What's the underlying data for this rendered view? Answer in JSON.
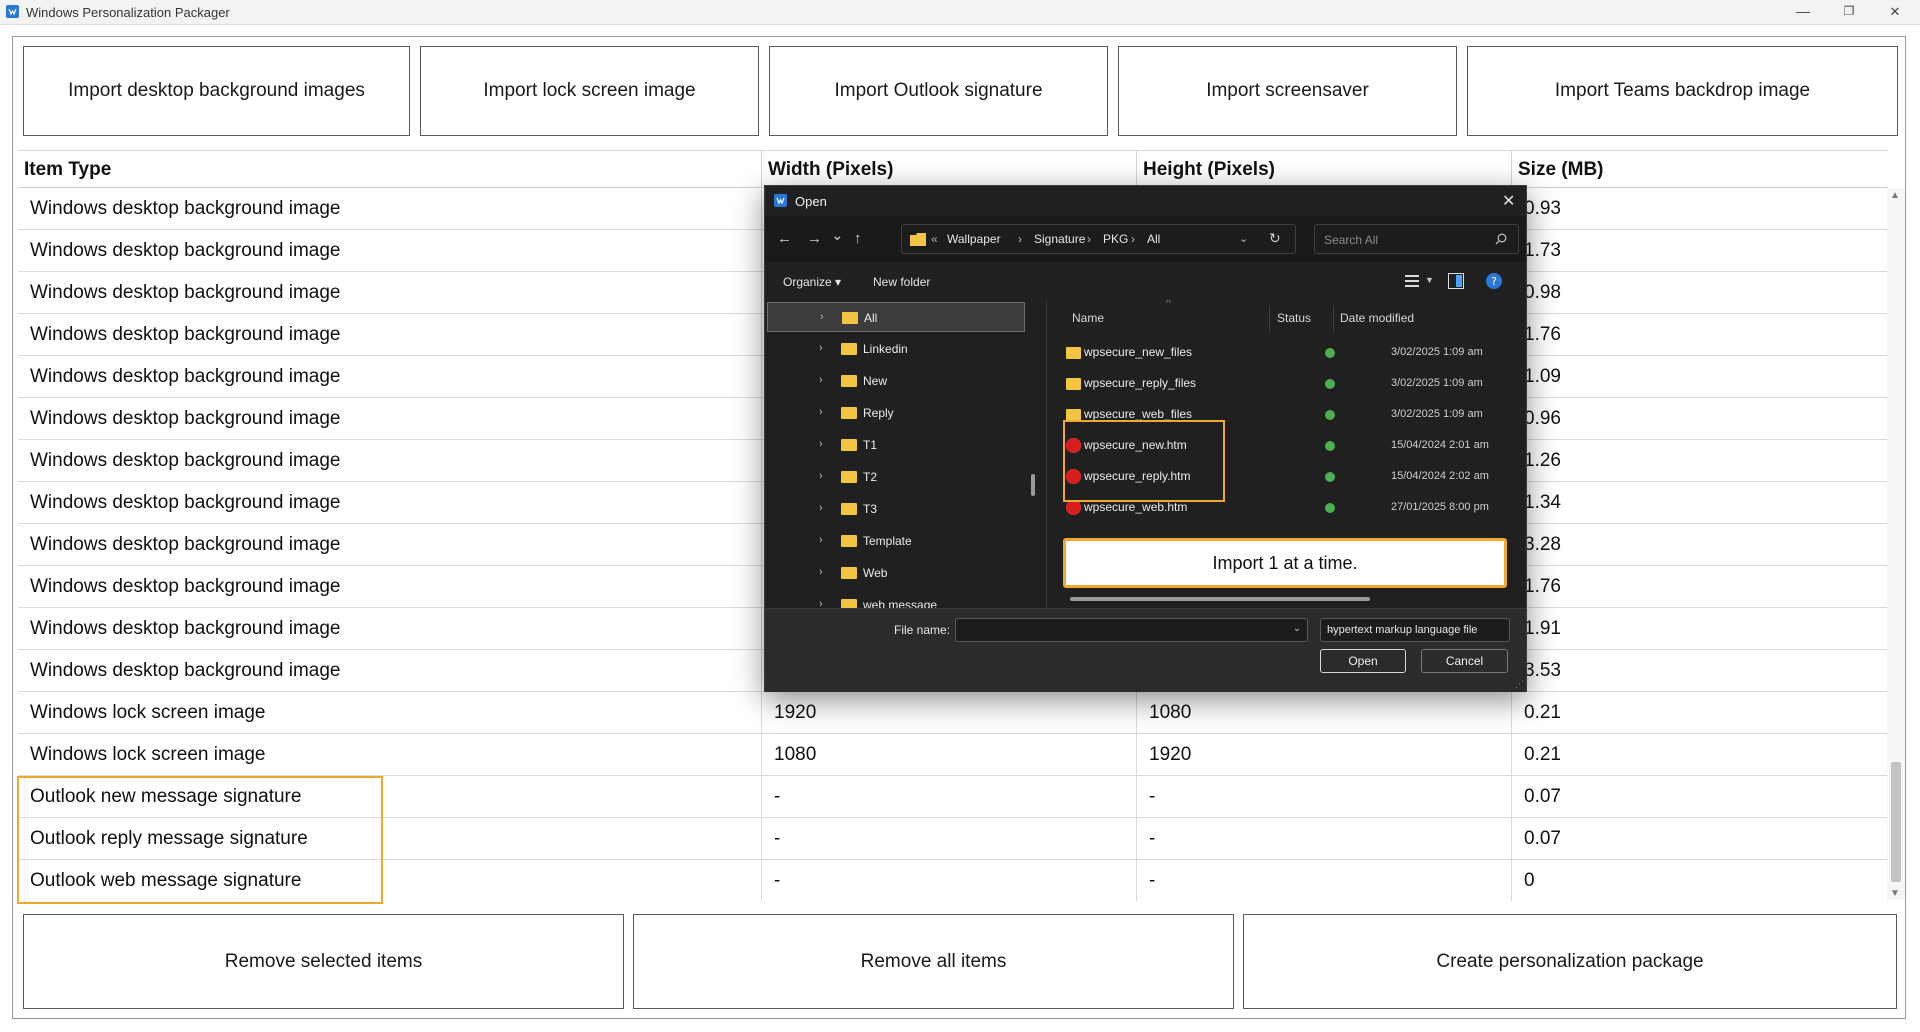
{
  "window": {
    "title": "Windows Personalization Packager",
    "minimize": "—",
    "restore": "❐",
    "close": "✕"
  },
  "top_buttons": [
    {
      "label": "Import desktop background images"
    },
    {
      "label": "Import lock screen image"
    },
    {
      "label": "Import Outlook signature"
    },
    {
      "label": "Import screensaver"
    },
    {
      "label": "Import Teams backdrop image"
    }
  ],
  "table": {
    "columns": [
      "Item Type",
      "Width (Pixels)",
      "Height (Pixels)",
      "Size (MB)"
    ],
    "rows": [
      {
        "type": "Windows desktop background image",
        "width": "",
        "height": "",
        "size": "0.93"
      },
      {
        "type": "Windows desktop background image",
        "width": "",
        "height": "",
        "size": "1.73"
      },
      {
        "type": "Windows desktop background image",
        "width": "",
        "height": "",
        "size": "0.98"
      },
      {
        "type": "Windows desktop background image",
        "width": "",
        "height": "",
        "size": "1.76"
      },
      {
        "type": "Windows desktop background image",
        "width": "",
        "height": "",
        "size": "1.09"
      },
      {
        "type": "Windows desktop background image",
        "width": "",
        "height": "",
        "size": "0.96"
      },
      {
        "type": "Windows desktop background image",
        "width": "",
        "height": "",
        "size": "1.26"
      },
      {
        "type": "Windows desktop background image",
        "width": "",
        "height": "",
        "size": "1.34"
      },
      {
        "type": "Windows desktop background image",
        "width": "",
        "height": "",
        "size": "3.28"
      },
      {
        "type": "Windows desktop background image",
        "width": "",
        "height": "",
        "size": "1.76"
      },
      {
        "type": "Windows desktop background image",
        "width": "",
        "height": "",
        "size": "1.91"
      },
      {
        "type": "Windows desktop background image",
        "width": "",
        "height": "",
        "size": "3.53"
      },
      {
        "type": "Windows lock screen image",
        "width": "1920",
        "height": "1080",
        "size": "0.21"
      },
      {
        "type": "Windows lock screen image",
        "width": "1080",
        "height": "1920",
        "size": "0.21"
      },
      {
        "type": "Outlook new message signature",
        "width": "-",
        "height": "-",
        "size": "0.07"
      },
      {
        "type": "Outlook reply message signature",
        "width": "-",
        "height": "-",
        "size": "0.07"
      },
      {
        "type": "Outlook web message signature",
        "width": "-",
        "height": "-",
        "size": "0"
      }
    ]
  },
  "bottom_buttons": [
    {
      "label": "Remove selected items"
    },
    {
      "label": "Remove all items"
    },
    {
      "label": "Create personalization package"
    }
  ],
  "dialog": {
    "title": "Open",
    "close": "✕",
    "nav": {
      "back": "←",
      "forward": "→",
      "recent": "⌄",
      "up": "↑",
      "refresh": "↻"
    },
    "breadcrumb": [
      "«",
      "Wallpaper",
      "›",
      "Signature",
      "›",
      "PKG",
      "›",
      "All"
    ],
    "search_placeholder": "Search All",
    "toolbar": {
      "organize": "Organize ▾",
      "new_folder": "New folder"
    },
    "tree": [
      {
        "label": "All",
        "selected": true
      },
      {
        "label": "Linkedin"
      },
      {
        "label": "New"
      },
      {
        "label": "Reply"
      },
      {
        "label": "T1"
      },
      {
        "label": "T2"
      },
      {
        "label": "T3"
      },
      {
        "label": "Template"
      },
      {
        "label": "Web"
      },
      {
        "label": "web message"
      }
    ],
    "columns": {
      "name": "Name",
      "status": "Status",
      "date": "Date modified"
    },
    "files": [
      {
        "name": "wpsecure_new_files",
        "kind": "folder",
        "date": "3/02/2025 1:09 am"
      },
      {
        "name": "wpsecure_reply_files",
        "kind": "folder",
        "date": "3/02/2025 1:09 am"
      },
      {
        "name": "wpsecure_web_files",
        "kind": "folder",
        "date": "3/02/2025 1:09 am"
      },
      {
        "name": "wpsecure_new.htm",
        "kind": "htm",
        "date": "15/04/2024 2:01 am"
      },
      {
        "name": "wpsecure_reply.htm",
        "kind": "htm",
        "date": "15/04/2024 2:02 am"
      },
      {
        "name": "wpsecure_web.htm",
        "kind": "htm",
        "date": "27/01/2025 8:00 pm"
      }
    ],
    "callout": "Import 1 at a time.",
    "file_name_label": "File name:",
    "file_name_value": "",
    "file_type": "hypertext markup language file",
    "open_label": "Open",
    "cancel_label": "Cancel"
  },
  "colors": {
    "highlight": "#f0a830",
    "dialog_bg": "#202020",
    "status_ok": "#4caf50"
  }
}
